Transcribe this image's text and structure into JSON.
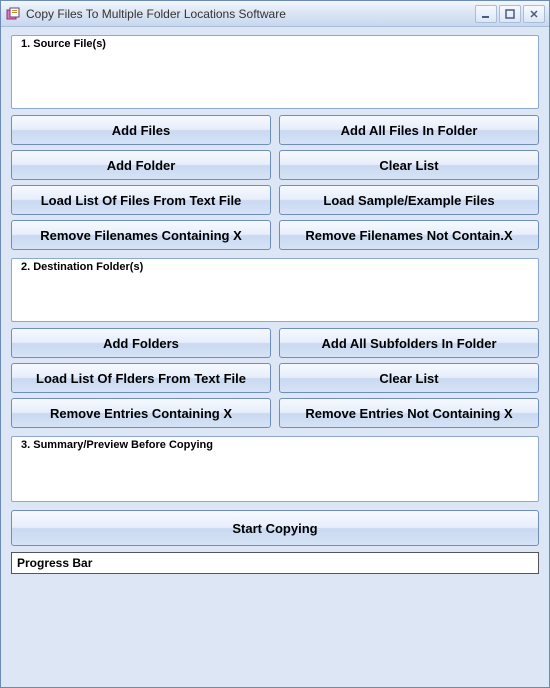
{
  "window": {
    "title": "Copy Files To Multiple Folder Locations Software"
  },
  "section1": {
    "label": "1. Source File(s)",
    "buttons": {
      "add_files": "Add Files",
      "add_all_files": "Add All Files In Folder",
      "add_folder": "Add Folder",
      "clear_list": "Clear List",
      "load_list": "Load List Of Files From Text File",
      "load_sample": "Load Sample/Example Files",
      "remove_containing": "Remove Filenames Containing X",
      "remove_not_containing": "Remove Filenames Not Contain.X"
    }
  },
  "section2": {
    "label": "2. Destination Folder(s)",
    "buttons": {
      "add_folders": "Add Folders",
      "add_all_subfolders": "Add All Subfolders In Folder",
      "load_list": "Load List Of Flders From Text File",
      "clear_list": "Clear List",
      "remove_containing": "Remove Entries Containing X",
      "remove_not_containing": "Remove Entries Not Containing X"
    }
  },
  "section3": {
    "label": "3. Summary/Preview Before Copying"
  },
  "action": {
    "start": "Start Copying"
  },
  "progress": {
    "label": "Progress Bar"
  }
}
